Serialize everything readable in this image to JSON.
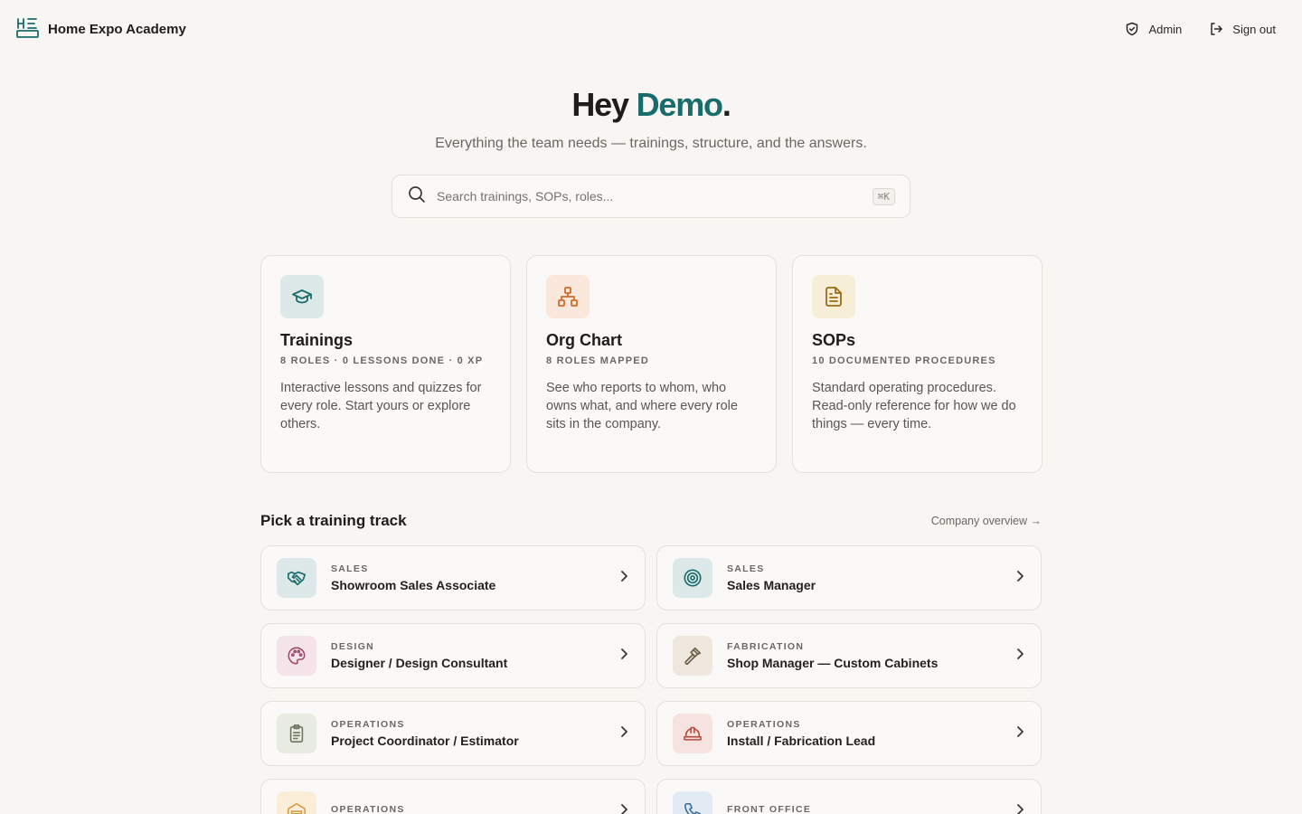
{
  "brand": {
    "name": "Home Expo Academy",
    "logo_icon": "store-logo-icon",
    "accent_color": "#1a6b6b"
  },
  "top_actions": {
    "admin_label": "Admin",
    "signout_label": "Sign out"
  },
  "hero": {
    "greeting": "Hey ",
    "name": "Demo",
    "punct": ".",
    "subtitle": "Everything the team needs — trainings, structure, and the answers."
  },
  "search": {
    "placeholder": "Search trainings, SOPs, roles...",
    "shortcut": "⌘K"
  },
  "features": [
    {
      "title": "Trainings",
      "meta": "8 ROLES · 0 LESSONS DONE · 0 XP",
      "desc": "Interactive lessons and quizzes for every role. Start yours or explore others.",
      "icon": "graduation-cap-icon",
      "color": "#1a6b6b",
      "bg": "#dde9e8"
    },
    {
      "title": "Org Chart",
      "meta": "8 ROLES MAPPED",
      "desc": "See who reports to whom, who owns what, and where every role sits in the company.",
      "icon": "org-chart-icon",
      "color": "#d4692a",
      "bg": "#fbe8dc"
    },
    {
      "title": "SOPs",
      "meta": "10 DOCUMENTED PROCEDURES",
      "desc": "Standard operating procedures. Read-only reference for how we do things — every time.",
      "icon": "document-icon",
      "color": "#9a6b12",
      "bg": "#f7eed8"
    }
  ],
  "tracks_section": {
    "title": "Pick a training track",
    "overview_link": "Company overview →"
  },
  "tracks": [
    {
      "category": "SALES",
      "title": "Showroom Sales Associate",
      "icon": "handshake-icon",
      "color": "#1a6b6b",
      "bg": "#dde9e8"
    },
    {
      "category": "SALES",
      "title": "Sales Manager",
      "icon": "target-icon",
      "color": "#1a6b6b",
      "bg": "#dde9e8"
    },
    {
      "category": "DESIGN",
      "title": "Designer / Design Consultant",
      "icon": "palette-icon",
      "color": "#9b4a6a",
      "bg": "#f4e4ea"
    },
    {
      "category": "FABRICATION",
      "title": "Shop Manager — Custom Cabinets",
      "icon": "hammer-icon",
      "color": "#6b5a44",
      "bg": "#ede7de"
    },
    {
      "category": "OPERATIONS",
      "title": "Project Coordinator / Estimator",
      "icon": "clipboard-icon",
      "color": "#6b7560",
      "bg": "#e8ebe2"
    },
    {
      "category": "OPERATIONS",
      "title": "Install / Fabrication Lead",
      "icon": "hard-hat-icon",
      "color": "#b84a3a",
      "bg": "#f6e3df"
    },
    {
      "category": "OPERATIONS",
      "title": "",
      "icon": "warehouse-icon",
      "color": "#d99a3a",
      "bg": "#fbeed8"
    },
    {
      "category": "FRONT OFFICE",
      "title": "",
      "icon": "phone-icon",
      "color": "#3a6b9b",
      "bg": "#e2eaf4"
    }
  ]
}
